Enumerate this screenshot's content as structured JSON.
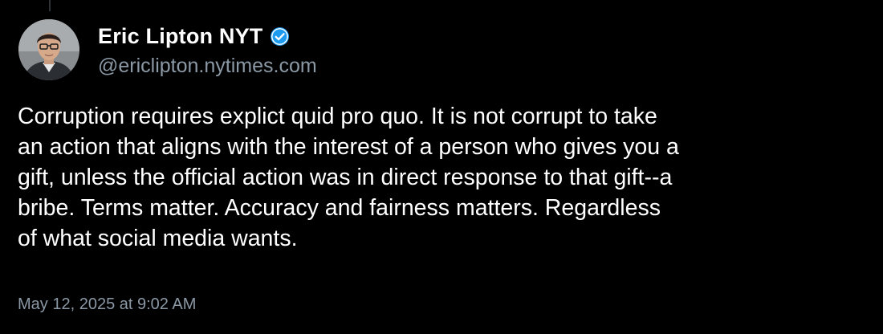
{
  "post": {
    "author": {
      "display_name": "Eric Lipton NYT",
      "handle": "@ericlipton.nytimes.com",
      "verified": true,
      "verified_icon": "verified-badge-icon",
      "avatar_icon": "profile-photo"
    },
    "text": "Corruption requires explict quid pro quo. It is not corrupt to take\nan action that aligns with the interest of a person who gives you a\ngift, unless the official action was in direct response to that gift--a\nbribe. Terms matter. Accuracy and fairness matters. Regardless\nof what social media wants.",
    "timestamp": "May 12, 2025 at 9:02 AM"
  },
  "colors": {
    "background": "#000000",
    "primary_text": "#ffffff",
    "secondary_text": "#8b98a5",
    "verified_badge": "#1d9bf0"
  }
}
